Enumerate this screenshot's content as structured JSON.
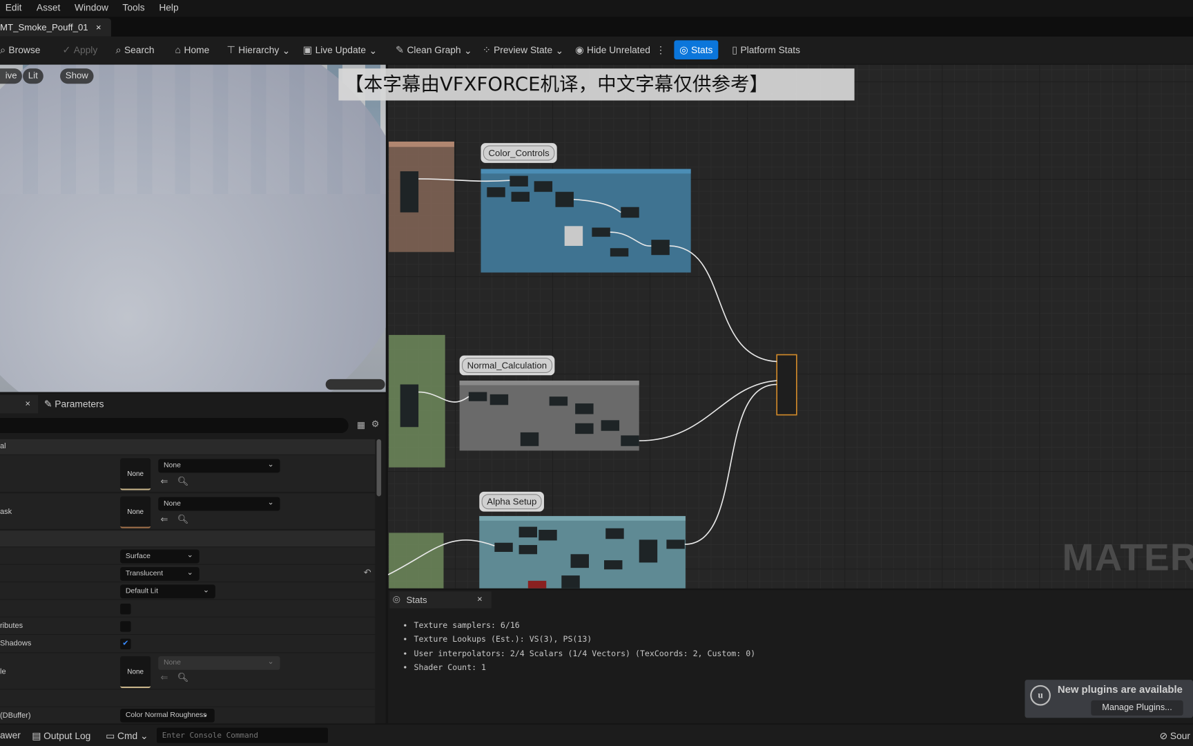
{
  "menu": [
    "Edit",
    "Asset",
    "Window",
    "Tools",
    "Help"
  ],
  "document_tab": {
    "title": "MT_Smoke_Pouff_01",
    "close": "×"
  },
  "toolbar": {
    "browse": "Browse",
    "apply": "Apply",
    "search": "Search",
    "home": "Home",
    "hierarchy": "Hierarchy",
    "live_update": "Live Update",
    "clean_graph": "Clean Graph",
    "preview_state": "Preview State",
    "hide_unrelated": "Hide Unrelated",
    "more": "⋮",
    "stats": "Stats",
    "platform_stats": "Platform Stats"
  },
  "viewport": {
    "pills": [
      "ive",
      "Lit",
      "Show"
    ]
  },
  "subtitle_overlay": "【本字幕由VFXFORCE机译，中文字幕仅供参考】",
  "graph": {
    "comments": [
      "Color_Controls",
      "Normal_Calculation",
      "Alpha Setup"
    ],
    "watermark": "MATERIA"
  },
  "details": {
    "close": "×",
    "parameters_tab": "Parameters",
    "section_1": "al",
    "rows": [
      {
        "label": "",
        "thumb": "None",
        "value": "None"
      },
      {
        "label": "ask",
        "thumb": "None",
        "value": "None"
      },
      {
        "label": "",
        "value": "Surface"
      },
      {
        "label": "",
        "value": "Translucent"
      },
      {
        "label": "",
        "value": "Default Lit"
      },
      {
        "label": "",
        "checked": false
      },
      {
        "label": "ributes",
        "checked": false
      },
      {
        "label": " Shadows",
        "checked": true
      },
      {
        "label": "le",
        "thumb": "None",
        "value": "None"
      },
      {
        "label": "(DBuffer)",
        "value": "Color Normal Roughness"
      }
    ],
    "reset_icon": "↶"
  },
  "stats": {
    "tab": "Stats",
    "close": "×",
    "lines": [
      "Texture samplers: 6/16",
      "Texture Lookups (Est.): VS(3), PS(13)",
      "User interpolators: 2/4 Scalars (1/4 Vectors) (TexCoords: 2, Custom: 0)",
      "Shader Count: 1"
    ]
  },
  "notification": {
    "title": "New plugins are available",
    "button": "Manage Plugins..."
  },
  "bottom_bar": {
    "drawer": "awer",
    "output_log": "Output Log",
    "cmd": "Cmd",
    "console_placeholder": "Enter Console Command",
    "source": "Sour"
  },
  "colors": {
    "accent": "#0b76db",
    "color_controls": "#3f7391",
    "normal_calc": "#6a6a6a",
    "alpha_setup": "#5f8a94",
    "output_node": "#d08a2a"
  }
}
